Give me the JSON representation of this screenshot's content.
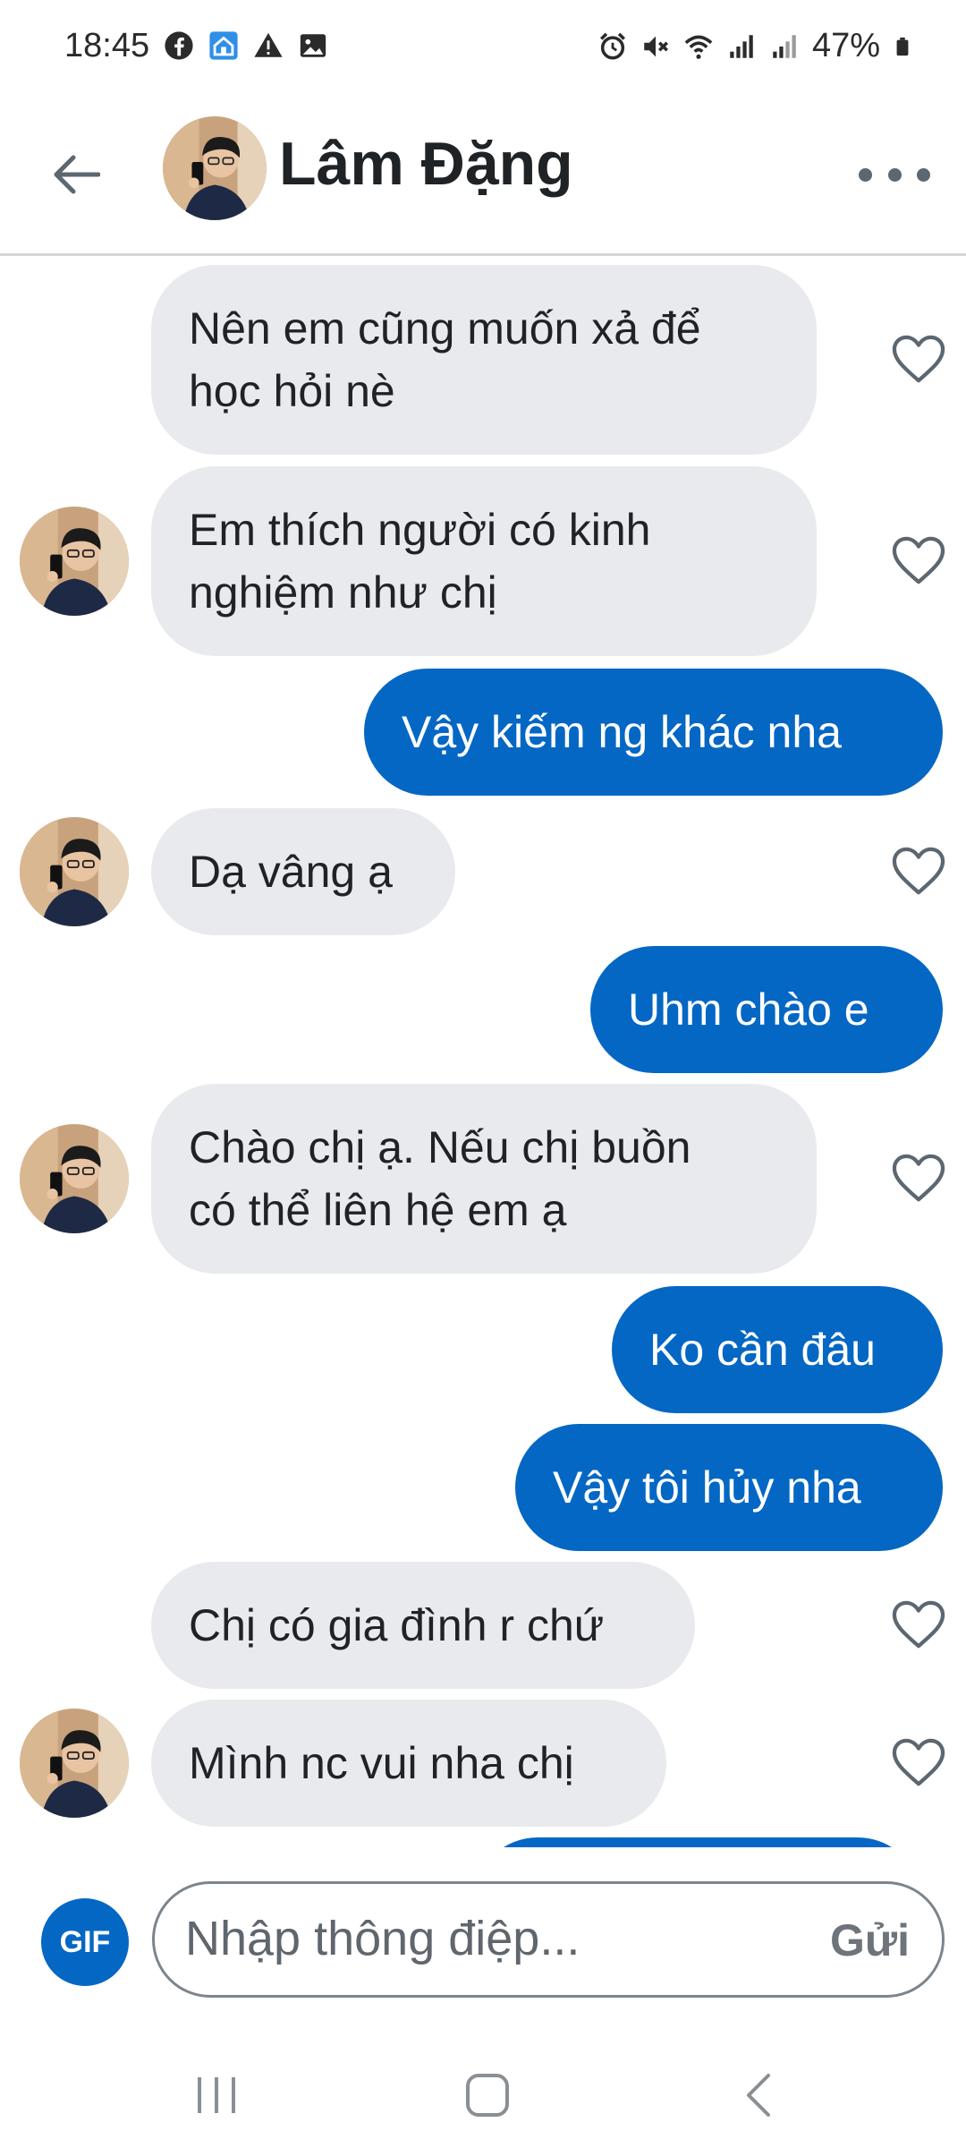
{
  "status_bar": {
    "time": "18:45",
    "battery": "47%",
    "left_icons": [
      "facebook-icon",
      "home-notification-icon",
      "warning-icon",
      "image-icon"
    ],
    "right_icons": [
      "alarm-icon",
      "mute-icon",
      "wifi-icon",
      "signal-icon",
      "signal-icon-2",
      "battery-icon"
    ]
  },
  "header": {
    "contact_name": "Lâm Đặng",
    "back_icon": "back-arrow-icon",
    "more_icon": "more-icon"
  },
  "messages": [
    {
      "dir": "in",
      "text_lines": [
        "Nên em cũng muốn xả để",
        "học hỏi nè"
      ],
      "avatar": false
    },
    {
      "dir": "in",
      "text_lines": [
        "Em thích người có kinh",
        "nghiệm như chị"
      ],
      "avatar": true
    },
    {
      "dir": "out",
      "text_lines": [
        "Vậy kiếm ng khác nha"
      ]
    },
    {
      "dir": "in",
      "text_lines": [
        "Dạ vâng ạ"
      ],
      "avatar": true
    },
    {
      "dir": "out",
      "text_lines": [
        "Uhm chào e"
      ]
    },
    {
      "dir": "in",
      "text_lines": [
        "Chào chị ạ. Nếu chị buồn",
        "có thể liên hệ em ạ"
      ],
      "avatar": true
    },
    {
      "dir": "out",
      "text_lines": [
        "Ko cần đâu"
      ]
    },
    {
      "dir": "out",
      "text_lines": [
        "Vậy tôi hủy nha"
      ]
    },
    {
      "dir": "in",
      "text_lines": [
        "Chị có gia đình r chứ"
      ],
      "avatar": false
    },
    {
      "dir": "in",
      "text_lines": [
        "Mình nc vui nha chị"
      ],
      "avatar": true
    }
  ],
  "composer": {
    "gif_label": "GIF",
    "placeholder": "Nhập thông điệp...",
    "send_label": "Gửi"
  },
  "colors": {
    "outgoing_bubble": "#0567c4",
    "incoming_bubble": "#e9eaee",
    "accent": "#0567c4"
  }
}
